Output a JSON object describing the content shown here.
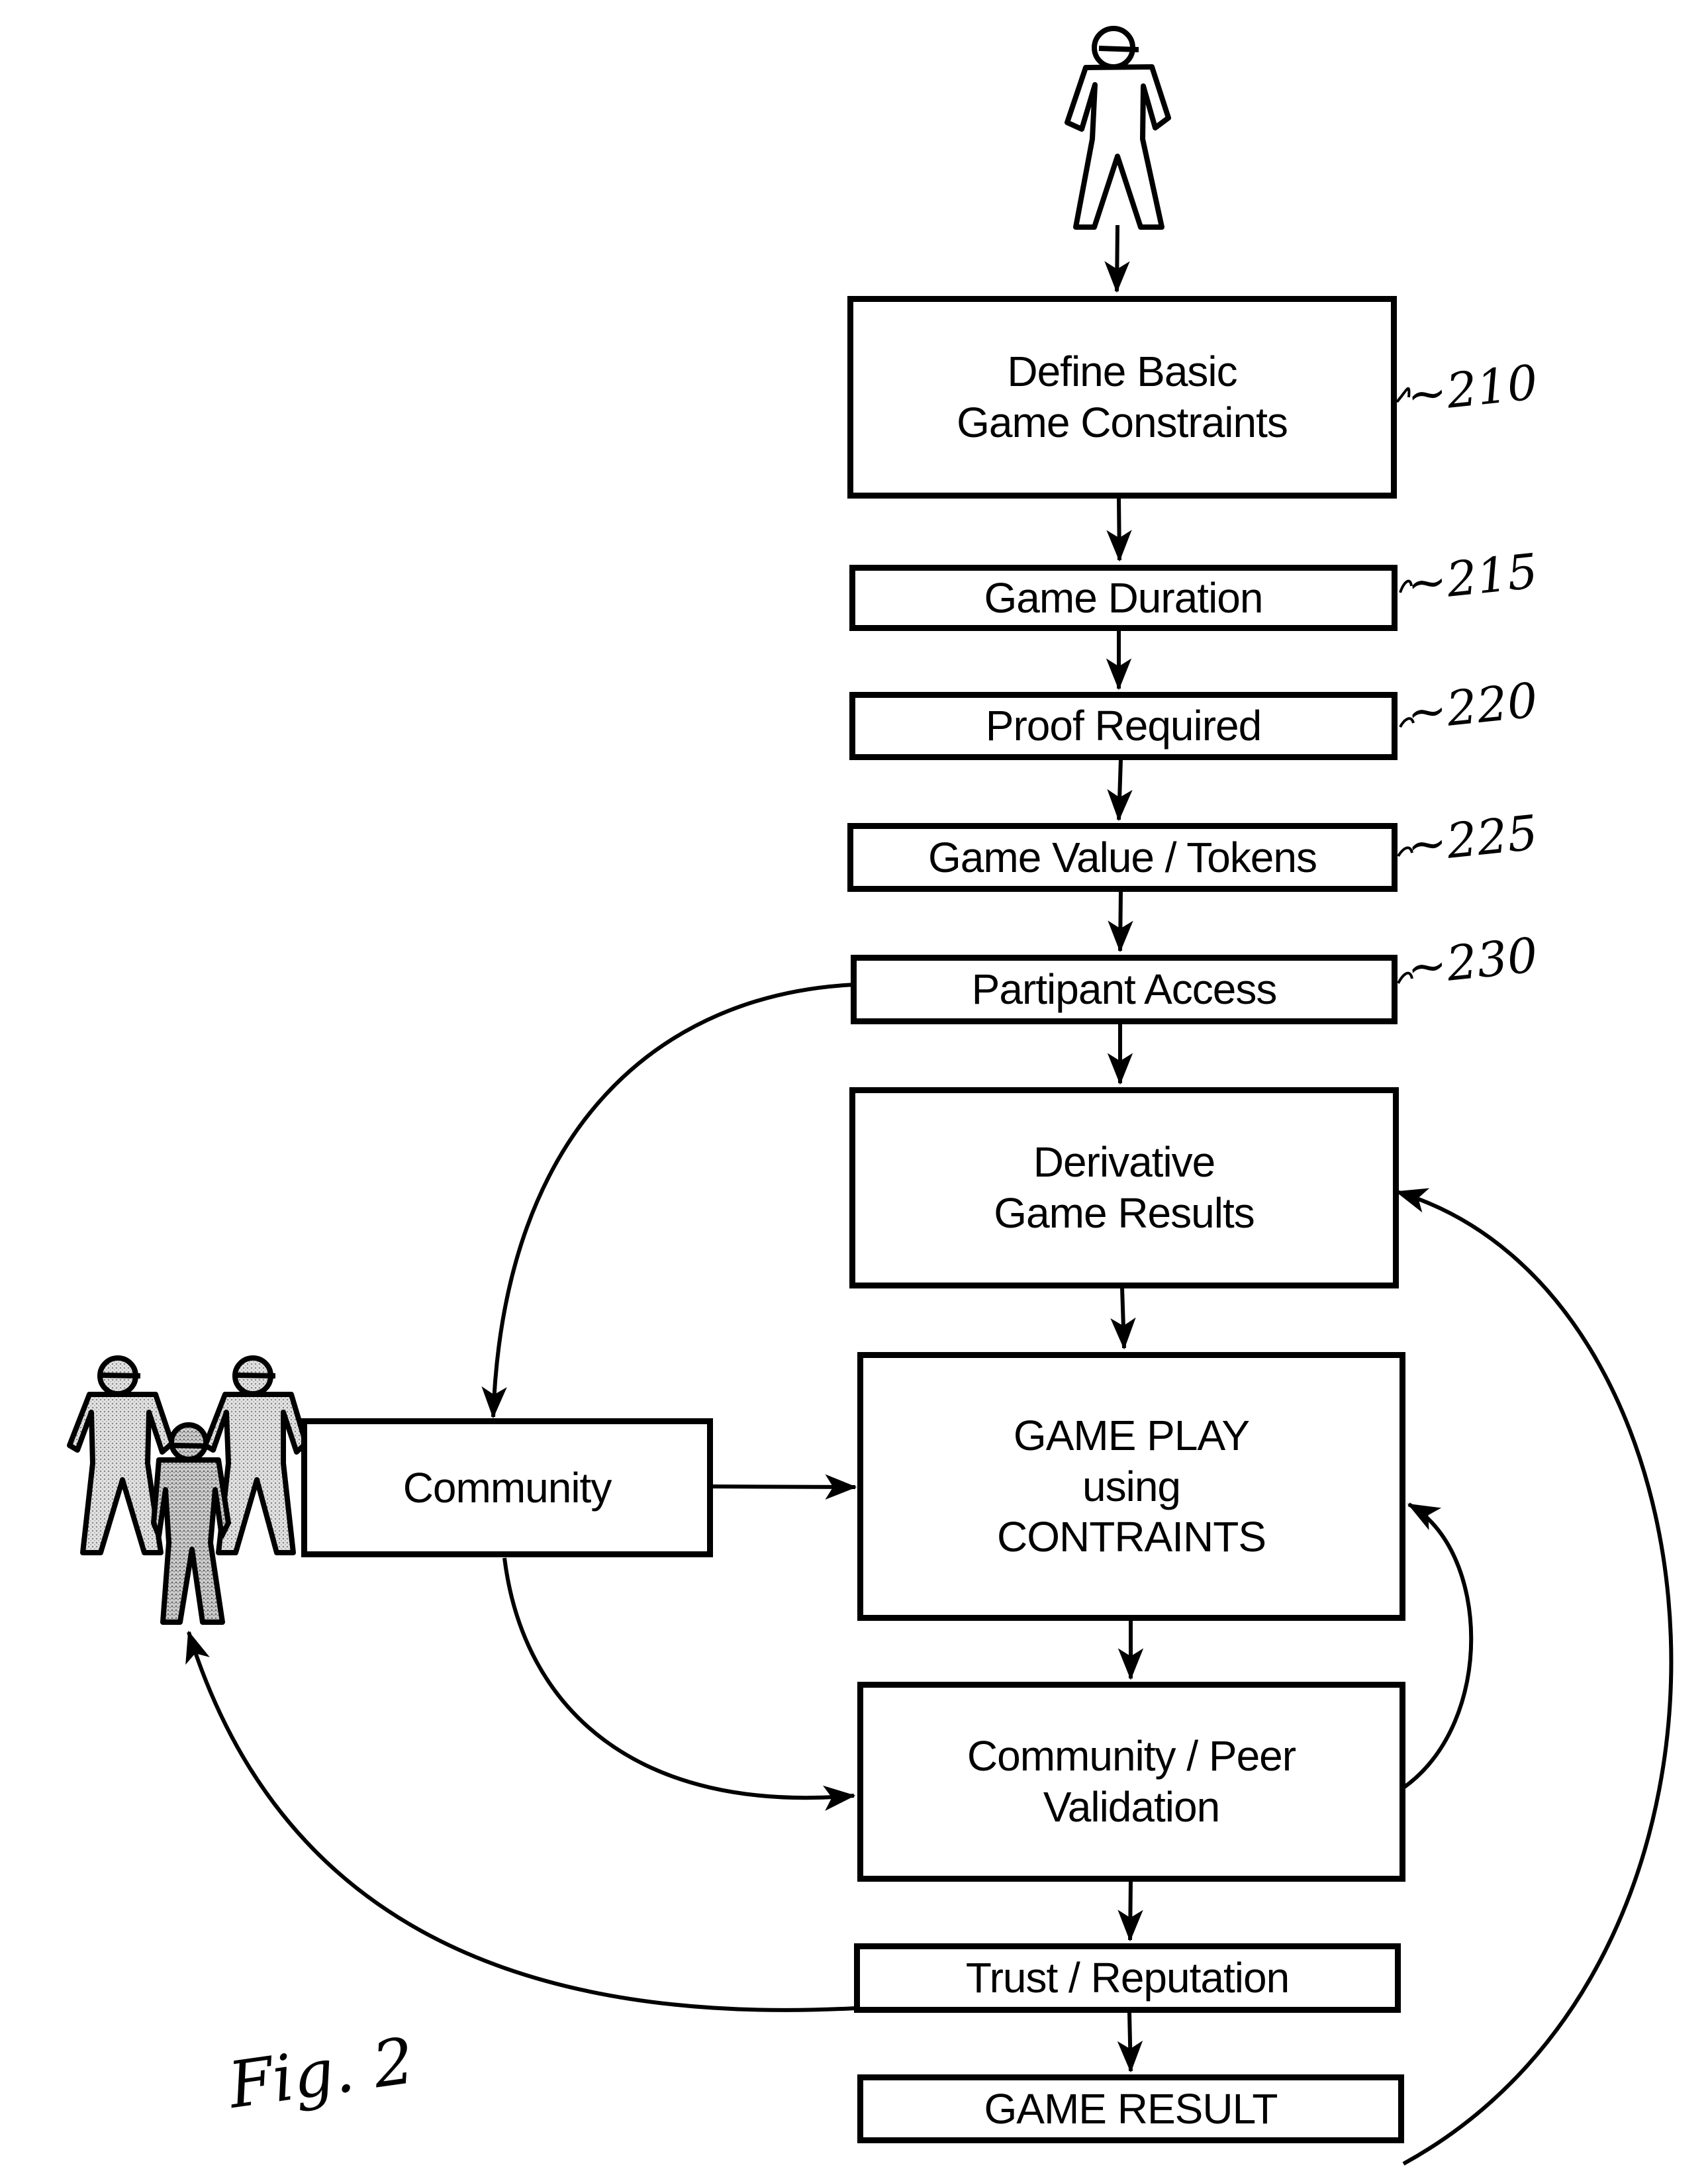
{
  "figure": {
    "label": "Fig. 2",
    "actors": {
      "single_user": "person-icon",
      "community_group": "group-icon"
    },
    "steps": [
      {
        "id": "define",
        "text": "Define Basic\nGame Constraints",
        "ref": "~210"
      },
      {
        "id": "duration",
        "text": "Game Duration",
        "ref": "~215"
      },
      {
        "id": "proof",
        "text": "Proof Required",
        "ref": "~220"
      },
      {
        "id": "value",
        "text": "Game Value / Tokens",
        "ref": "~225"
      },
      {
        "id": "access",
        "text": "Partipant Access",
        "ref": "~230"
      },
      {
        "id": "derivative",
        "text": "Derivative\nGame Results"
      },
      {
        "id": "community",
        "text": "Community"
      },
      {
        "id": "gameplay",
        "text": "GAME PLAY\nusing\nCONTRAINTS"
      },
      {
        "id": "validation",
        "text": "Community / Peer\nValidation"
      },
      {
        "id": "trust",
        "text": "Trust / Reputation"
      },
      {
        "id": "result",
        "text": "GAME RESULT"
      }
    ],
    "connections": [
      {
        "from": "single_user",
        "to": "define"
      },
      {
        "from": "define",
        "to": "duration"
      },
      {
        "from": "duration",
        "to": "proof"
      },
      {
        "from": "proof",
        "to": "value"
      },
      {
        "from": "value",
        "to": "access"
      },
      {
        "from": "access",
        "to": "derivative"
      },
      {
        "from": "access",
        "to": "community"
      },
      {
        "from": "derivative",
        "to": "gameplay"
      },
      {
        "from": "community",
        "to": "gameplay"
      },
      {
        "from": "community",
        "to": "validation"
      },
      {
        "from": "gameplay",
        "to": "validation"
      },
      {
        "from": "validation",
        "to": "gameplay"
      },
      {
        "from": "validation",
        "to": "trust"
      },
      {
        "from": "trust",
        "to": "community_group"
      },
      {
        "from": "trust",
        "to": "result"
      },
      {
        "from": "result",
        "to": "derivative"
      }
    ]
  }
}
